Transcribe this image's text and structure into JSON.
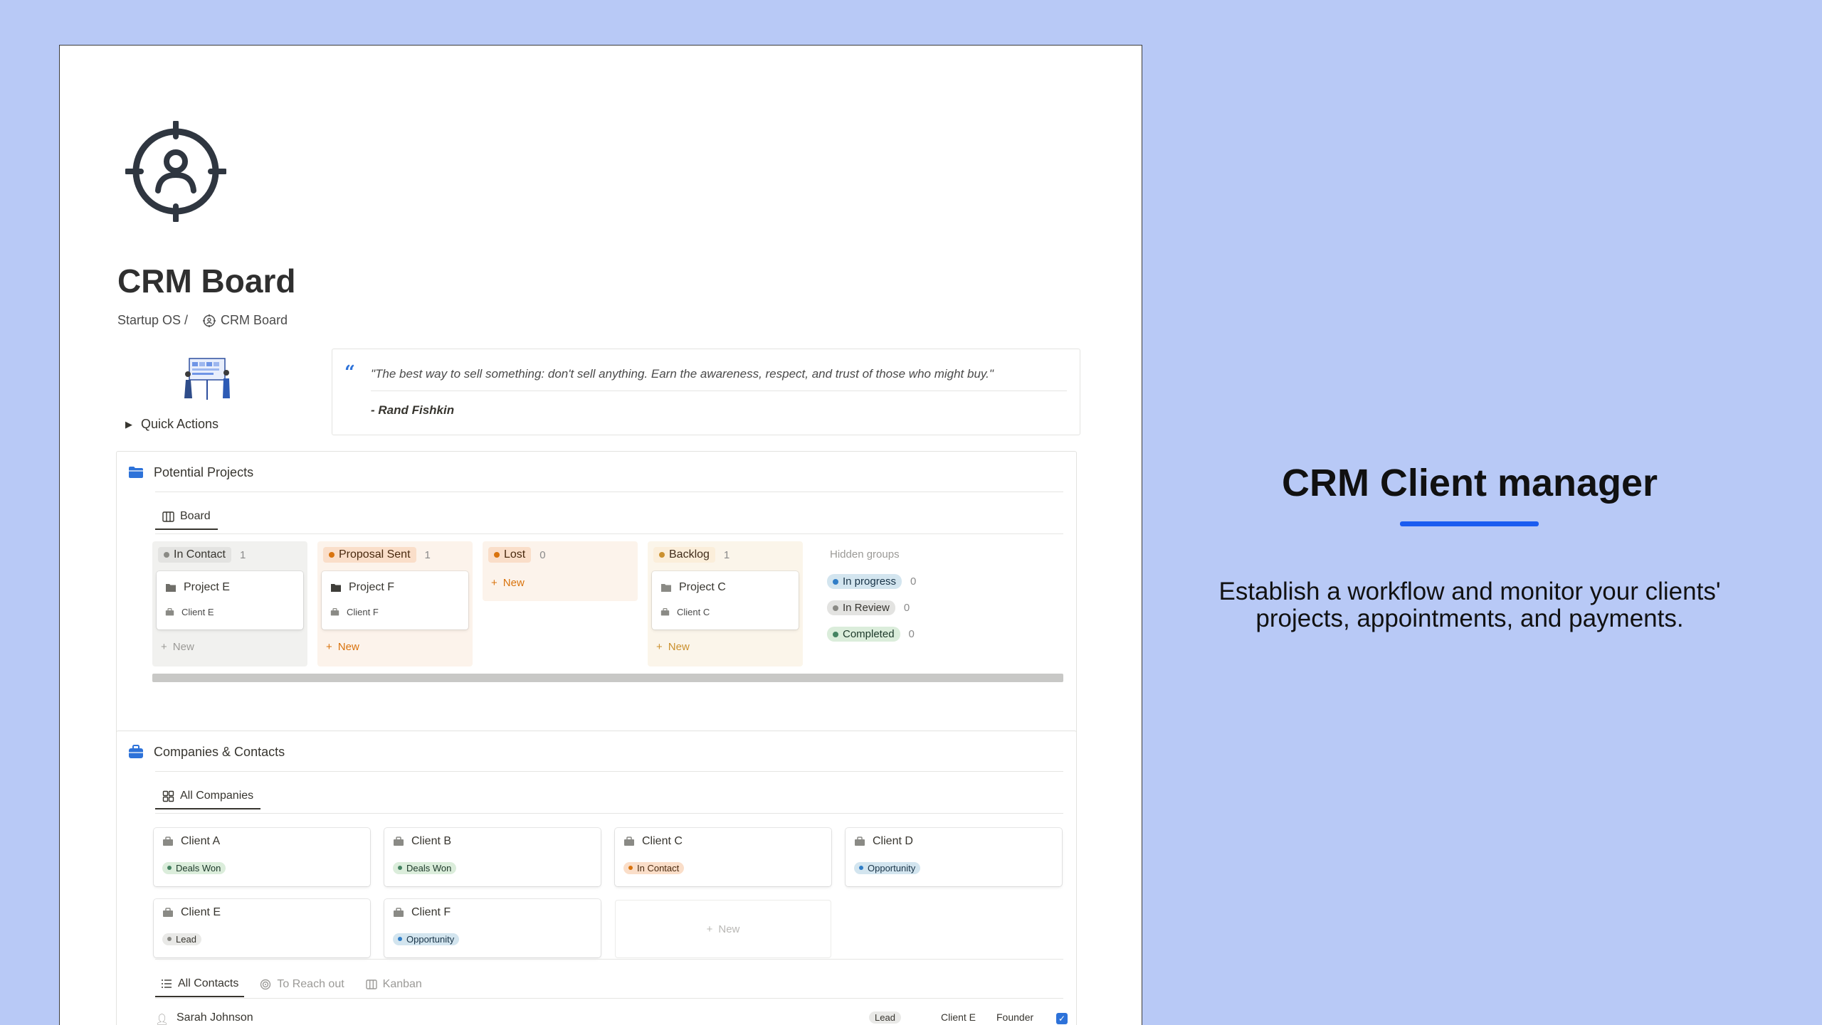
{
  "page": {
    "title": "CRM Board",
    "breadcrumb": {
      "root": "Startup OS /",
      "current": "CRM Board"
    },
    "quick_actions": "Quick Actions",
    "quote": {
      "mark": "“",
      "text": "\"The best way to sell something: don't sell anything. Earn the awareness, respect, and trust of those who might buy.\"",
      "author": "- Rand Fishkin"
    }
  },
  "projects": {
    "title": "Potential Projects",
    "view_tab": "Board",
    "columns": [
      {
        "label": "In Contact",
        "count": "1",
        "color": "#8a8a85",
        "bg": "#f1f1ef",
        "pill_bg": "#e3e3e1",
        "text": "#37352f",
        "card": {
          "title": "Project E",
          "client": "Client E"
        },
        "new": "New"
      },
      {
        "label": "Proposal Sent",
        "count": "1",
        "color": "#d9730d",
        "bg": "#fcf3eb",
        "pill_bg": "#fadec9",
        "text": "#49290e",
        "card": {
          "title": "Project F",
          "client": "Client F"
        },
        "new": "New"
      },
      {
        "label": "Lost",
        "count": "0",
        "color": "#d9730d",
        "bg": "#fcf3eb",
        "pill_bg": "#fadec9",
        "text": "#49290e",
        "new": "New"
      },
      {
        "label": "Backlog",
        "count": "1",
        "color": "#cb912f",
        "bg": "#fbf5ea",
        "pill_bg": "#fbeeda",
        "text": "#402c1b",
        "card": {
          "title": "Project C",
          "client": "Client C"
        },
        "new": "New"
      }
    ],
    "hidden_groups": {
      "label": "Hidden groups",
      "items": [
        {
          "label": "In progress",
          "count": "0",
          "color": "#2f7dc7",
          "pill_bg": "#d3e5ef",
          "text": "#183347"
        },
        {
          "label": "In Review",
          "count": "0",
          "color": "#8a8a85",
          "pill_bg": "#e3e3e1",
          "text": "#37352f"
        },
        {
          "label": "Completed",
          "count": "0",
          "color": "#448361",
          "pill_bg": "#dbeddb",
          "text": "#1c3829"
        }
      ]
    }
  },
  "companies": {
    "title": "Companies & Contacts",
    "view_tab": "All Companies",
    "cards": [
      {
        "name": "Client A",
        "tag": "Deals Won",
        "color": "#448361",
        "pill_bg": "#dbeddb",
        "text": "#1c3829"
      },
      {
        "name": "Client B",
        "tag": "Deals Won",
        "color": "#448361",
        "pill_bg": "#dbeddb",
        "text": "#1c3829"
      },
      {
        "name": "Client C",
        "tag": "In Contact",
        "color": "#d9730d",
        "pill_bg": "#fadec9",
        "text": "#49290e"
      },
      {
        "name": "Client D",
        "tag": "Opportunity",
        "color": "#2f7dc7",
        "pill_bg": "#d3e5ef",
        "text": "#183347"
      },
      {
        "name": "Client E",
        "tag": "Lead",
        "color": "#8a8a85",
        "pill_bg": "#e9e9e7",
        "text": "#37352f"
      },
      {
        "name": "Client F",
        "tag": "Opportunity",
        "color": "#2f7dc7",
        "pill_bg": "#d3e5ef",
        "text": "#183347"
      }
    ],
    "new": "New",
    "contacts_tabs": [
      "All Contacts",
      "To Reach out",
      "Kanban"
    ],
    "contact_row": {
      "name": "Sarah Johnson",
      "tag": "Lead",
      "company": "Client E",
      "role": "Founder"
    }
  },
  "promo": {
    "title": "CRM Client manager",
    "subtitle_line1": "Establish a workflow and monitor your clients'",
    "subtitle_line2": "projects, appointments, and payments.",
    "accent": "#1a5cf0"
  }
}
